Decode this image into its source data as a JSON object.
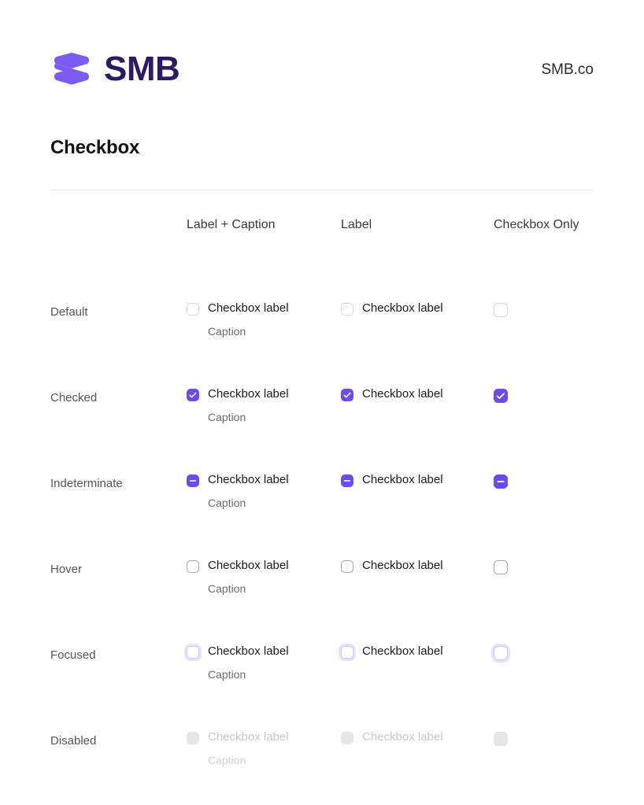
{
  "header": {
    "logo_icon": "smb-ribbon-logo-icon",
    "brand_word": "SMB",
    "site_link": "SMB.co"
  },
  "colors": {
    "brand_purple": "#6d4aec",
    "brand_dark": "#2e1a63",
    "border_default": "#d5d7db",
    "border_hover": "#a0a4ac",
    "focus_ring": "#e7e1fb",
    "disabled_fill": "#e4e6e9"
  },
  "page": {
    "title": "Checkbox"
  },
  "table": {
    "corner_header": "",
    "columns": [
      {
        "label": "Label + Caption",
        "variant": "label-caption"
      },
      {
        "label": "Label",
        "variant": "label-only"
      },
      {
        "label": "Checkbox Only",
        "variant": "checkbox-only"
      }
    ],
    "label_text": "Checkbox label",
    "caption_text": "Caption",
    "rows": [
      {
        "state": "Default",
        "key": "default",
        "mark": "none"
      },
      {
        "state": "Checked",
        "key": "checked",
        "mark": "check"
      },
      {
        "state": "Indeterminate",
        "key": "indeterminate",
        "mark": "dash"
      },
      {
        "state": "Hover",
        "key": "hover",
        "mark": "none"
      },
      {
        "state": "Focused",
        "key": "focused",
        "mark": "none"
      },
      {
        "state": "Disabled",
        "key": "disabled",
        "mark": "none"
      }
    ]
  }
}
